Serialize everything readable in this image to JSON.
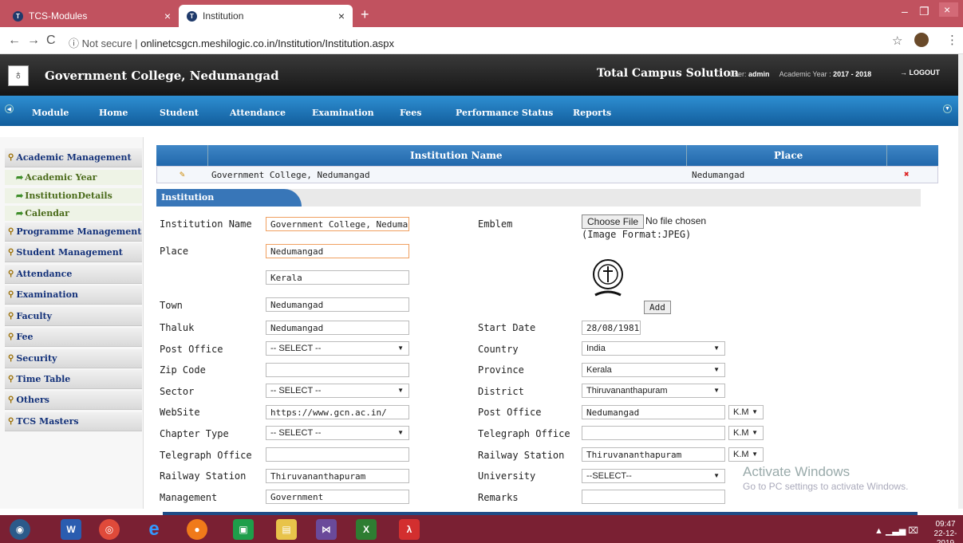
{
  "browser": {
    "tabs": [
      {
        "label": "TCS-Modules",
        "close": "×"
      },
      {
        "label": "Institution",
        "close": "×"
      }
    ],
    "new_tab": "+",
    "url_prefix": "ⓘ Not secure |",
    "url": "onlinetcsgcn.meshilogic.co.in/Institution/Institution.aspx"
  },
  "header": {
    "college": "Government College, Nedumangad",
    "product": "Total Campus Solution",
    "user_label": "User:",
    "user": "admin",
    "year_label": "Academic Year :",
    "year": "2017 - 2018",
    "logout": "→ LOGOUT"
  },
  "nav": [
    "Module",
    "Home",
    "Student",
    "Attendance",
    "Examination",
    "Fees",
    "Performance Status",
    "Reports"
  ],
  "sidebar": {
    "items": [
      "Academic Management",
      "Programme Management",
      "Student Management",
      "Attendance",
      "Examination",
      "Faculty",
      "Fee",
      "Security",
      "Time Table",
      "Others",
      "TCS Masters"
    ],
    "subitems": [
      "Academic Year",
      "InstitutionDetails",
      "Calendar"
    ]
  },
  "grid": {
    "headers": [
      "Institution Name",
      "Place"
    ],
    "row": {
      "name": "Government College, Nedumangad",
      "place": "Nedumangad",
      "edit_icon": "✎",
      "delete_icon": "✖"
    }
  },
  "section": {
    "title": "Institution"
  },
  "form": {
    "institution_name": {
      "label": "Institution Name",
      "value": "Government College, Nedumangad"
    },
    "place": {
      "label": "Place",
      "value": "Nedumangad"
    },
    "state": {
      "value": "Kerala"
    },
    "town": {
      "label": "Town",
      "value": "Nedumangad"
    },
    "thaluk": {
      "label": "Thaluk",
      "value": "Nedumangad"
    },
    "post_office_left": {
      "label": "Post Office",
      "value": "-- SELECT --"
    },
    "zip": {
      "label": "Zip Code",
      "value": ""
    },
    "sector": {
      "label": "Sector",
      "value": "-- SELECT --"
    },
    "website": {
      "label": "WebSite",
      "value": "https://www.gcn.ac.in/"
    },
    "chapter_type": {
      "label": "Chapter Type",
      "value": "-- SELECT --"
    },
    "telegraph_left": {
      "label": "Telegraph Office",
      "value": ""
    },
    "railway_left": {
      "label": "Railway Station",
      "value": "Thiruvananthapuram"
    },
    "management": {
      "label": "Management",
      "value": "Government"
    },
    "emblem": {
      "label": "Emblem",
      "choose": "Choose File",
      "nofile": "No file chosen",
      "format": "(Image Format:JPEG)",
      "add": "Add"
    },
    "start_date": {
      "label": "Start Date",
      "value": "28/08/1981"
    },
    "country": {
      "label": "Country",
      "value": "India"
    },
    "province": {
      "label": "Province",
      "value": "Kerala"
    },
    "district": {
      "label": "District",
      "value": "Thiruvananthapuram"
    },
    "post_office_right": {
      "label": "Post Office",
      "value": "Nedumangad",
      "unit": "K.M"
    },
    "telegraph_right": {
      "label": "Telegraph Office",
      "value": "",
      "unit": "K.M"
    },
    "railway_right": {
      "label": "Railway Station",
      "value": "Thiruvananthapuram",
      "unit": "K.M"
    },
    "university": {
      "label": "University",
      "value": "--SELECT--"
    },
    "remarks": {
      "label": "Remarks",
      "value": ""
    }
  },
  "watermark": {
    "line1": "Activate Windows",
    "line2": "Go to PC settings to activate Windows."
  },
  "taskbar": {
    "time": "09:47",
    "date": "22-12-2019"
  }
}
